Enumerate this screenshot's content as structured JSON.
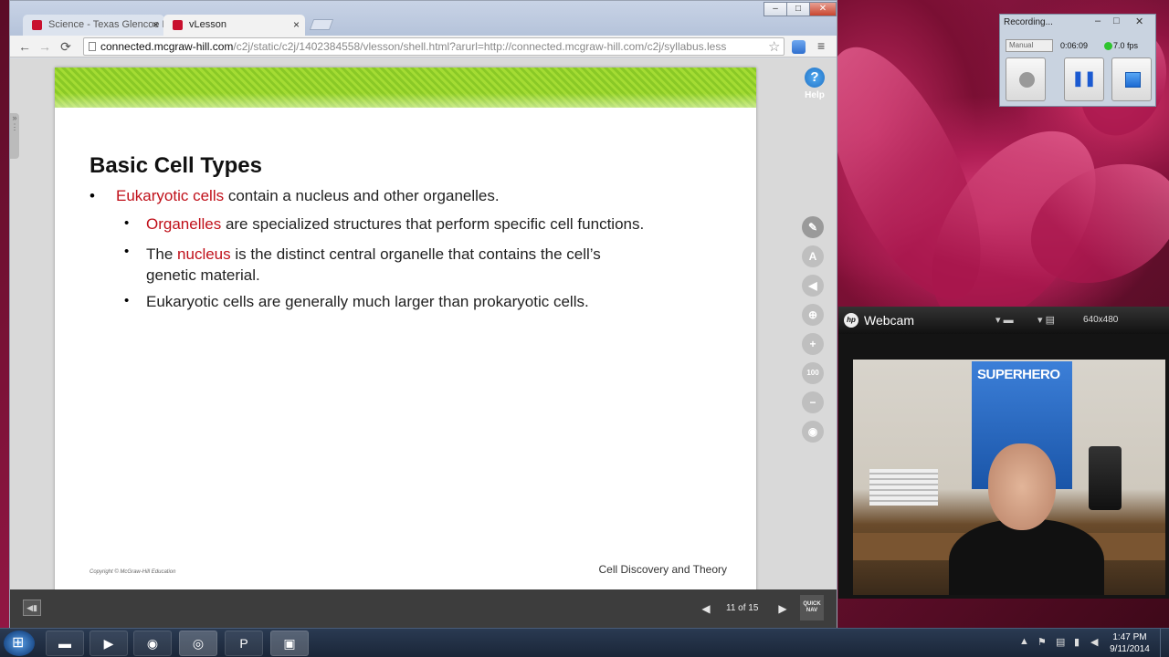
{
  "browser": {
    "tabs": [
      {
        "label": "Science - Texas Glencoe N",
        "close": "×"
      },
      {
        "label": "vLesson",
        "close": "×"
      }
    ],
    "window_controls": {
      "minimize": "–",
      "maximize": "□",
      "close": "✕"
    },
    "nav": {
      "back": "←",
      "forward": "→",
      "reload": "⟳"
    },
    "url_host": "connected.mcgraw-hill.com",
    "url_path": "/c2j/static/c2j/1402384558/vlesson/shell.html?arurl=http://connected.mcgraw-hill.com/c2j/syllabus.less",
    "star": "☆",
    "menu": "≡"
  },
  "help": {
    "icon": "?",
    "label": "Help"
  },
  "tools": [
    {
      "name": "pencil-icon",
      "glyph": "✎"
    },
    {
      "name": "highlighter-icon",
      "glyph": "A"
    },
    {
      "name": "audio-icon",
      "glyph": "◀"
    },
    {
      "name": "zoom-fit-icon",
      "glyph": "⊕"
    },
    {
      "name": "zoom-in-icon",
      "glyph": "+"
    },
    {
      "name": "zoom-100-icon",
      "glyph": "100"
    },
    {
      "name": "zoom-out-icon",
      "glyph": "−"
    },
    {
      "name": "eye-icon",
      "glyph": "◉"
    }
  ],
  "slide": {
    "title": "Basic Cell Types",
    "bullet": "•",
    "b1_term": "Eukaryotic cells",
    "b1_text": " contain a nucleus and other organelles.",
    "sub1_term": "Organelles",
    "sub1_text": " are specialized structures that perform specific cell functions.",
    "sub2_pre": "The ",
    "sub2_term": "nucleus",
    "sub2_text": " is the distinct central organelle that contains the cell’s",
    "sub2_text2": "genetic material.",
    "sub3_text": "Eukaryotic cells are generally much larger than prokaryotic cells.",
    "copyright": "Copyright © McGraw-Hill Education",
    "footer": "Cell Discovery and Theory"
  },
  "pager": {
    "prev": "◀",
    "next": "▶",
    "count": "11 of 15",
    "quicknav": "QUICK NAV"
  },
  "recording": {
    "title": "Recording...",
    "mode": "Manual",
    "elapsed": "0:06:09",
    "fps": "7.0 fps",
    "pause": "❚❚",
    "controls": {
      "minimize": "–",
      "maximize": "□",
      "close": "✕"
    }
  },
  "webcam": {
    "title": "Webcam",
    "resolution": "640x480",
    "poster": "SUPERHERO",
    "hp": "hp"
  },
  "taskbar": {
    "time": "1:47 PM",
    "date": "9/11/2014"
  }
}
